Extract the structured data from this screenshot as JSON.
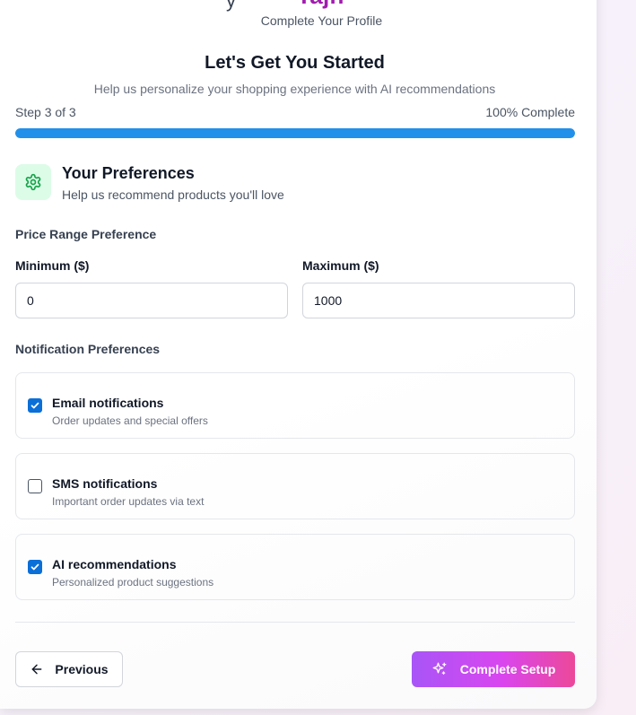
{
  "brand": {
    "prefix_partial": "y",
    "name": "Tajh"
  },
  "header": {
    "subtitle": "Complete Your Profile",
    "title": "Let's Get You Started",
    "description": "Help us personalize your shopping experience with AI recommendations"
  },
  "progress": {
    "step_label": "Step 3 of 3",
    "percent_label": "100% Complete",
    "value": 1.0,
    "color": "#2190ea"
  },
  "section": {
    "icon": "gear-icon",
    "title": "Your Preferences",
    "description": "Help us recommend products you'll love"
  },
  "price_range": {
    "label": "Price Range Preference",
    "min_label": "Minimum ($)",
    "min_value": "0",
    "max_label": "Maximum ($)",
    "max_value": "1000"
  },
  "notifications": {
    "label": "Notification Preferences",
    "items": [
      {
        "title": "Email notifications",
        "description": "Order updates and special offers",
        "checked": true
      },
      {
        "title": "SMS notifications",
        "description": "Important order updates via text",
        "checked": false
      },
      {
        "title": "AI recommendations",
        "description": "Personalized product suggestions",
        "checked": true
      }
    ]
  },
  "footer": {
    "previous_label": "Previous",
    "previous_icon": "arrow-left-icon",
    "complete_label": "Complete Setup",
    "complete_icon": "sparkles-icon"
  }
}
